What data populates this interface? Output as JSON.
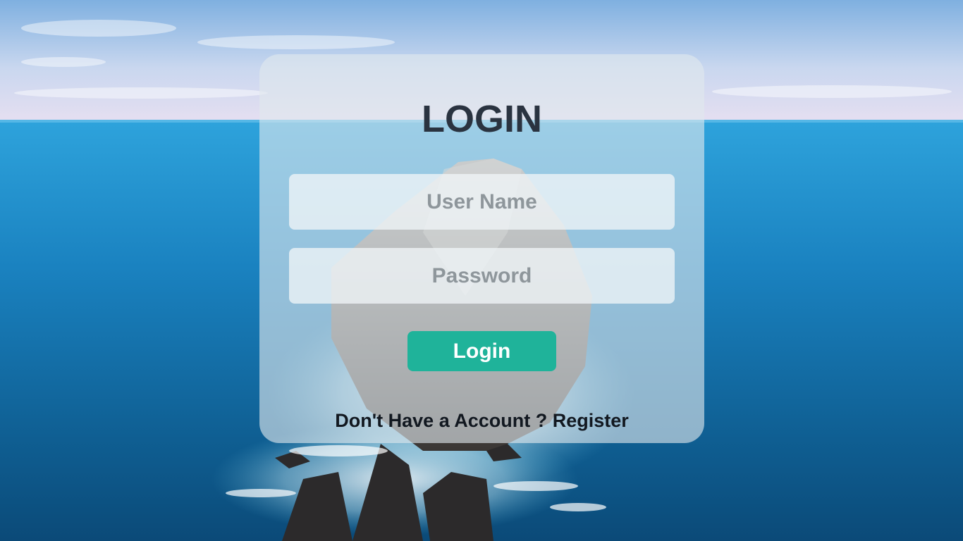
{
  "login_card": {
    "title": "LOGIN",
    "username": {
      "placeholder": "User Name",
      "value": ""
    },
    "password": {
      "placeholder": "Password",
      "value": ""
    },
    "submit_label": "Login",
    "register_prompt": "Don't Have a Account ? Register"
  },
  "colors": {
    "button": "#1fb39a",
    "title": "#2a3340",
    "card": "#e1e8ee",
    "ocean": "#1f6ea3",
    "sky": "#c7d6ee"
  },
  "background": {
    "icon": "ocean-island-photo"
  }
}
